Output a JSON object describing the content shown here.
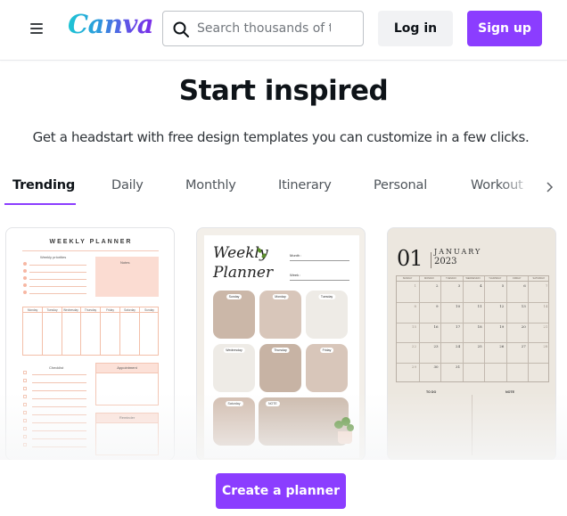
{
  "header": {
    "menu_icon": "hamburger-menu-icon",
    "logo_text": "Canva",
    "search": {
      "placeholder": "Search thousands of t",
      "value": "",
      "icon": "search-icon"
    },
    "login_label": "Log in",
    "signup_label": "Sign up"
  },
  "hero": {
    "title": "Start inspired",
    "subtitle": "Get a headstart with free design templates you can customize in a few clicks."
  },
  "tabs": {
    "items": [
      {
        "label": "Trending",
        "active": true
      },
      {
        "label": "Daily",
        "active": false
      },
      {
        "label": "Monthly",
        "active": false
      },
      {
        "label": "Itinerary",
        "active": false
      },
      {
        "label": "Personal",
        "active": false
      },
      {
        "label": "Workout",
        "active": false
      }
    ],
    "next_icon": "chevron-right-icon"
  },
  "templates": [
    {
      "name": "Weekly planner (pink)",
      "heading": "WEEKLY PLANNER",
      "priorities_label": "Weekly priorities",
      "notes_label": "Notes",
      "days": [
        "Monday",
        "Tuesday",
        "Wednesday",
        "Thursday",
        "Friday",
        "Saturday",
        "Sunday"
      ],
      "checklist_label": "Checklist",
      "appointment_label": "Appointment",
      "reminder_label": "Reminder",
      "accent": "#fbdcd2"
    },
    {
      "name": "Weekly planner (beige)",
      "heading_line1": "Weekly",
      "heading_line2": "Planner",
      "month_label": "Month :",
      "week_label": "Week :",
      "days": [
        "Sunday",
        "Monday",
        "Tuesday",
        "Wednesday",
        "Thursday",
        "Friday",
        "Saturday"
      ],
      "note_label": "NOTE",
      "accent": "#cbb9ab"
    },
    {
      "name": "January 2023 calendar",
      "number": "01",
      "month": "JANUARY",
      "year": "2023",
      "weekdays": [
        "SUNDAY",
        "MONDAY",
        "TUESDAY",
        "WEDNESDAY",
        "THURSDAY",
        "FRIDAY",
        "SATURDAY"
      ],
      "weeks": [
        [
          "1",
          "2",
          "3",
          "4",
          "5",
          "6",
          "7"
        ],
        [
          "8",
          "9",
          "10",
          "11",
          "12",
          "13",
          "14"
        ],
        [
          "15",
          "16",
          "17",
          "18",
          "19",
          "20",
          "21"
        ],
        [
          "22",
          "23",
          "24",
          "25",
          "26",
          "27",
          "28"
        ],
        [
          "29",
          "30",
          "31",
          "",
          "",
          "",
          ""
        ]
      ],
      "todo_label": "TO DO",
      "note_label": "NOTE"
    }
  ],
  "cta_label": "Create a planner",
  "colors": {
    "brand": "#8b3dff",
    "text": "#0e1318"
  }
}
